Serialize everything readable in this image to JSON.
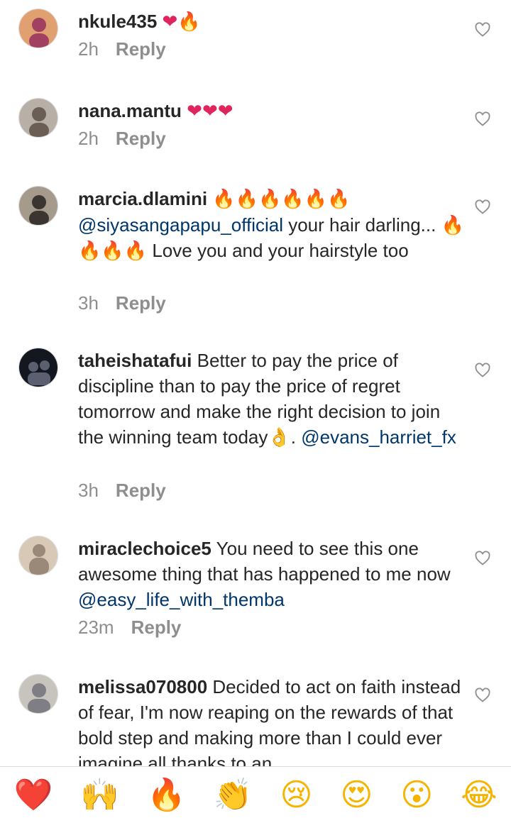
{
  "comments": [
    {
      "username": "nkule435",
      "text_parts": [
        "",
        "❤🔥",
        ""
      ],
      "time": "2h",
      "reply_label": "Reply",
      "avatar_colors": [
        "#a14060",
        "#e0a070"
      ]
    },
    {
      "username": "nana.mantu",
      "text_parts": [
        "",
        "❤❤❤",
        ""
      ],
      "time": "2h",
      "reply_label": "Reply",
      "avatar_colors": [
        "#6b5f55",
        "#b8b0a6"
      ]
    },
    {
      "username": "marcia.dlamini",
      "text_parts": [
        "🔥🔥🔥🔥🔥🔥 ",
        "@siyasangapapu_official",
        " your hair darling... 🔥🔥🔥🔥 Love you and your hairstyle too"
      ],
      "time": "3h",
      "reply_label": "Reply",
      "avatar_colors": [
        "#3a3530",
        "#a59a8c"
      ]
    },
    {
      "username": "taheishatafui",
      "text_parts": [
        "Better to pay the price of discipline than to pay the price of regret tomorrow and make the right decision to join the winning team today👌. ",
        "@evans_harriet_fx",
        ""
      ],
      "time": "3h",
      "reply_label": "Reply",
      "avatar_colors": [
        "#14171f",
        "#5a6070"
      ]
    },
    {
      "username": "miraclechoice5",
      "text_parts": [
        "You need to see this one awesome thing that has happened to me now ",
        "@easy_life_with_themba",
        ""
      ],
      "time": "23m",
      "reply_label": "Reply",
      "avatar_colors": [
        "#9a8878",
        "#d8c8b6"
      ]
    },
    {
      "username": "melissa070800",
      "text_parts": [
        "Decided to act on faith instead of fear, I'm now reaping on the rewards of that bold step and making more than I could ever imagine all thanks to an",
        "",
        ""
      ],
      "time": "",
      "reply_label": "",
      "avatar_colors": [
        "#7f7e84",
        "#c7c3bd"
      ]
    }
  ],
  "quick_reactions": [
    "❤️",
    "🙌",
    "🔥",
    "👏",
    "😢",
    "😍",
    "😮",
    "😂"
  ],
  "colors": {
    "text": "#262626",
    "secondary": "#8e8e8e",
    "mention": "#00376b",
    "divider": "#dbdbdb"
  }
}
